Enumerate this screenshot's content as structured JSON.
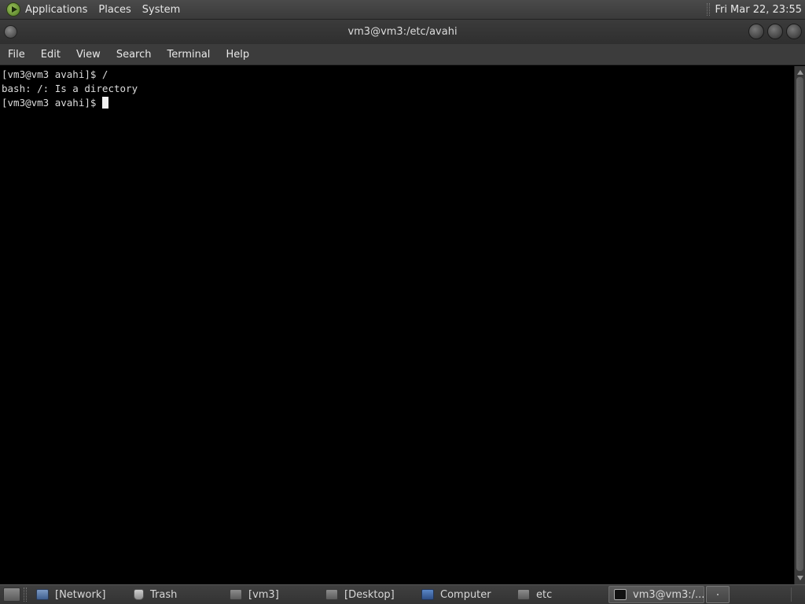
{
  "top_panel": {
    "menus": [
      "Applications",
      "Places",
      "System"
    ],
    "clock": "Fri Mar 22, 23:55"
  },
  "window": {
    "title": "vm3@vm3:/etc/avahi",
    "menu": [
      "File",
      "Edit",
      "View",
      "Search",
      "Terminal",
      "Help"
    ]
  },
  "terminal": {
    "lines": [
      "[vm3@vm3 avahi]$ /",
      "bash: /: Is a directory",
      "[vm3@vm3 avahi]$ "
    ]
  },
  "taskbar": {
    "tasks": [
      {
        "label": "[Network]",
        "icon": "network-icon"
      },
      {
        "label": "Trash",
        "icon": "trash-icon"
      },
      {
        "label": "[vm3]",
        "icon": "folder-icon"
      },
      {
        "label": "[Desktop]",
        "icon": "folder-icon"
      },
      {
        "label": "Computer",
        "icon": "computer-icon"
      },
      {
        "label": "etc",
        "icon": "folder-icon"
      },
      {
        "label": "vm3@vm3:/...",
        "icon": "terminal-icon",
        "active": true
      }
    ]
  }
}
